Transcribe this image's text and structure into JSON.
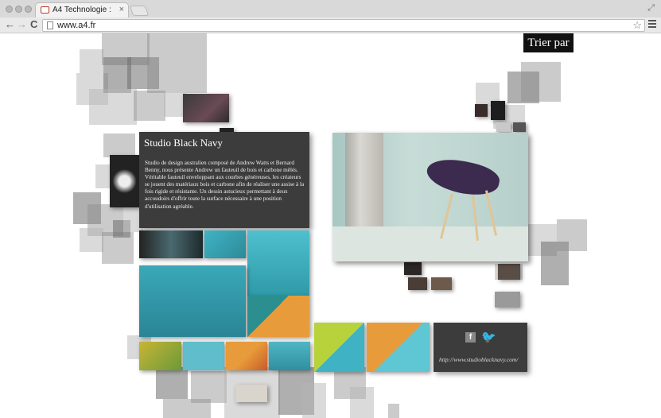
{
  "browser": {
    "tab_title": "A4 Technologie :",
    "tab_close": "×",
    "url": "www.a4.fr",
    "back": "←",
    "forward": "→",
    "reload": "C",
    "star": "☆",
    "expand": "⤢"
  },
  "page": {
    "sort_label": "Trier par",
    "panel_title": "Studio Black Navy",
    "panel_text": "Studio de design australien composé de Andrew Watts et Bernard Benny, nous présente Andrew un fauteuil de bois et carbone mêlés. Véritable fauteuil enveloppant aux courbes généreuses, les créateurs se jouent des matériaux bois et carbone afin de réaliser une assise à la fois rigide et résistante. Un dessin astucieux permettant à deux accoudoirs d'offrir toute la surface nécessaire à une position d'utilisation agréable.",
    "facebook_glyph": "f",
    "twitter_glyph": "🐦",
    "site_link": "http://www.studioblacknavy.com/"
  },
  "colors": {
    "panel_bg": "#3c3c3c",
    "sort_bg": "#111111",
    "accent_cyan": "#3fb3c4",
    "accent_orange": "#e89b3b"
  }
}
